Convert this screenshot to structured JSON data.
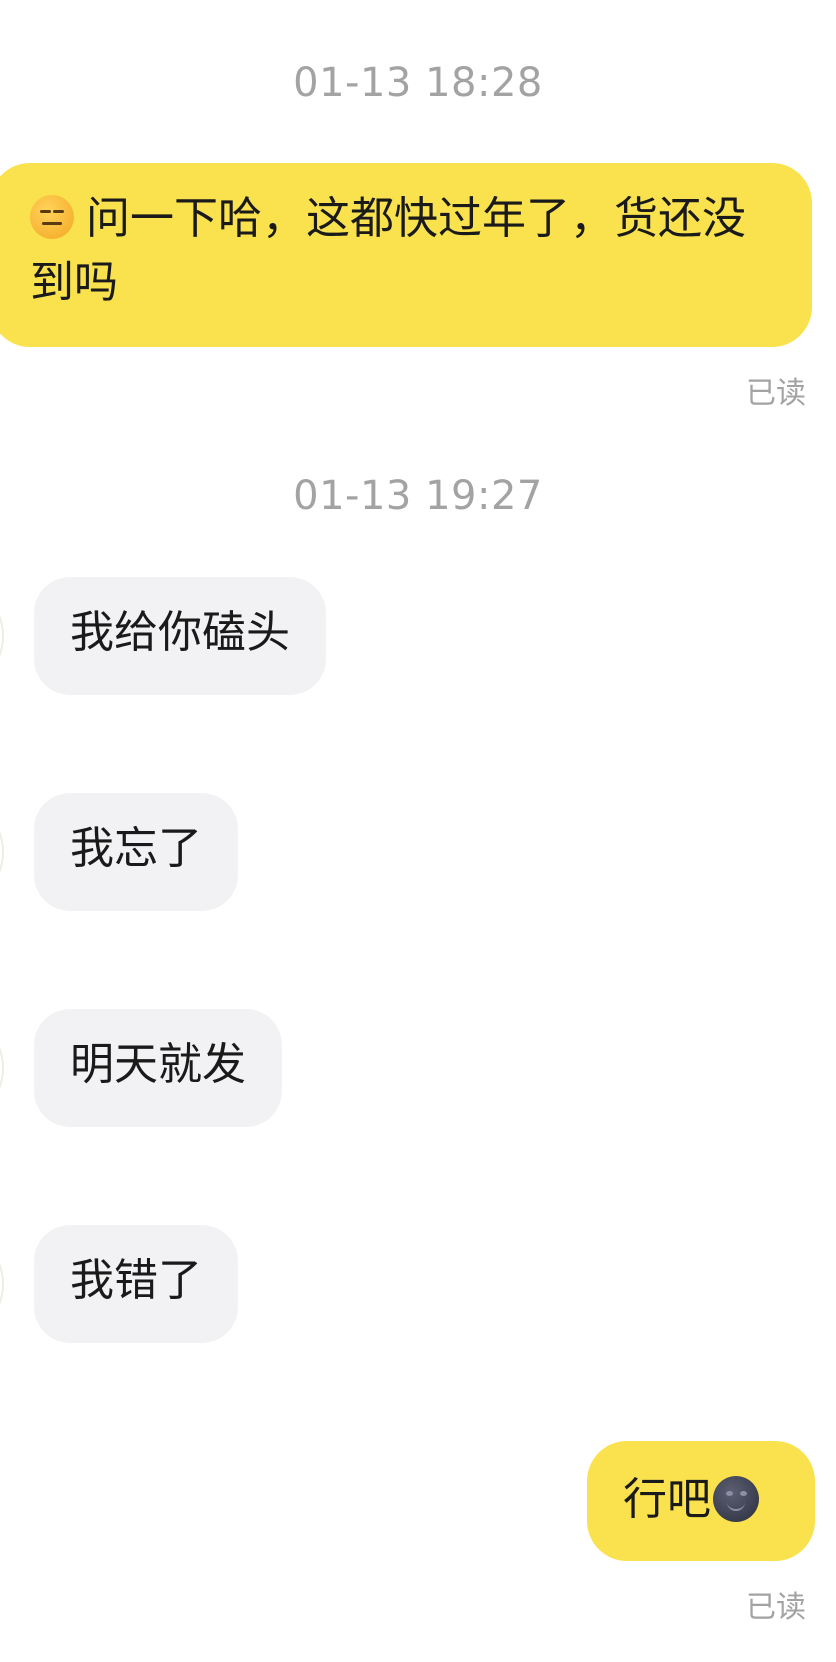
{
  "chat": {
    "timestamp_1": "01-13 18:28",
    "msg_out_1": "问一下哈，这都快过年了，货还没到吗",
    "msg_out_1_emoji": "expressionless-face-icon",
    "read_1": "已读",
    "timestamp_2": "01-13 19:27",
    "msg_in_1": "我给你磕头",
    "msg_in_2": "我忘了",
    "msg_in_3": "明天就发",
    "msg_in_4": "我错了",
    "msg_out_2": "行吧",
    "msg_out_2_emoji": "new-moon-face-icon",
    "read_2": "已读"
  },
  "colors": {
    "outgoing_bubble": "#f9e24e",
    "incoming_bubble": "#f2f2f4",
    "timestamp_text": "#a3a3a3",
    "message_text": "#1a1a1a"
  }
}
